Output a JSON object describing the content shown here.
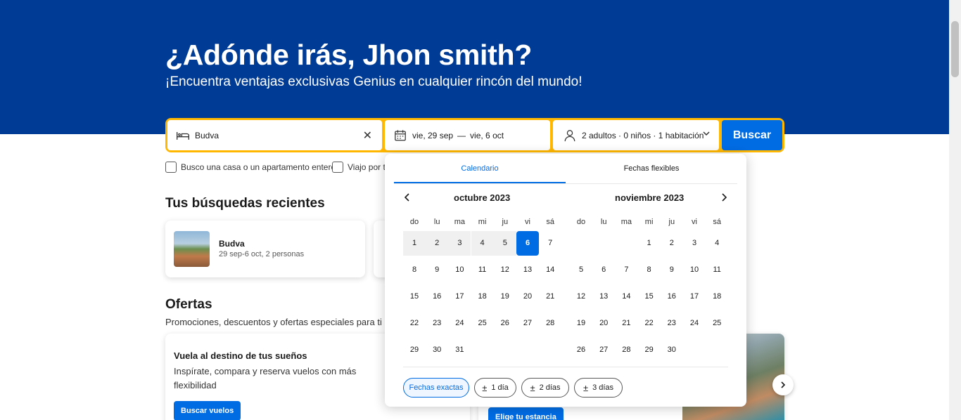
{
  "hero": {
    "title": "¿Adónde irás, Jhon smith?",
    "subtitle": "¡Encuentra ventajas exclusivas Genius en cualquier rincón del mundo!"
  },
  "search": {
    "destination": "Budva",
    "clear_icon": "close-icon",
    "date_from": "vie, 29 sep",
    "date_sep": "—",
    "date_to": "vie, 6 oct",
    "guests": "2 adultos · 0 niños · 1 habitación",
    "button": "Buscar"
  },
  "checkboxes": [
    {
      "label": "Busco una casa o un apartamento entero",
      "checked": false
    },
    {
      "label": "Viajo por t",
      "checked": false
    }
  ],
  "recent": {
    "title": "Tus búsquedas recientes",
    "items": [
      {
        "name": "Budva",
        "meta": "29 sep-6 oct, 2 personas"
      }
    ]
  },
  "offers": {
    "title": "Ofertas",
    "subtitle": "Promociones, descuentos y ofertas especiales para ti",
    "cards": [
      {
        "title": "Vuela al destino de tus sueños",
        "text": "Inspírate, compara y reserva vuelos con más flexibilidad",
        "button": "Buscar vuelos"
      },
      {
        "button": "Elige tu estancia"
      }
    ]
  },
  "calendar": {
    "tabs": [
      "Calendario",
      "Fechas flexibles"
    ],
    "active_tab": 0,
    "weekdays": [
      "do",
      "lu",
      "ma",
      "mi",
      "ju",
      "vi",
      "sá"
    ],
    "months": [
      {
        "title": "octubre 2023",
        "offset": 0,
        "days": 31
      },
      {
        "title": "noviembre 2023",
        "offset": 3,
        "days": 30
      }
    ],
    "selection": {
      "month": 0,
      "range_start": 1,
      "end": 6
    },
    "flex_chips": [
      "Fechas exactas",
      "1 día",
      "2 días",
      "3 días"
    ],
    "flex_prefix": "±",
    "active_chip": 0
  },
  "colors": {
    "brand_blue": "#003b95",
    "accent_blue": "#006ce4",
    "search_border": "#ffb700"
  }
}
